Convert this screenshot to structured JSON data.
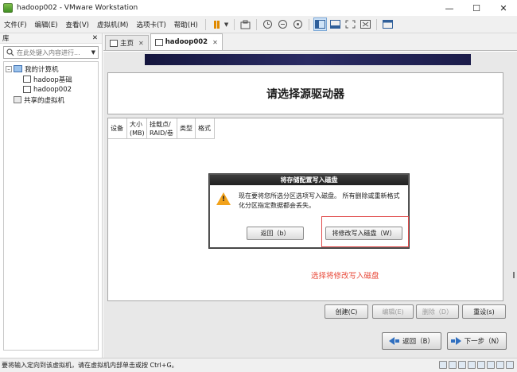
{
  "window": {
    "title": "hadoop002 - VMware Workstation"
  },
  "menu": [
    "文件(F)",
    "编辑(E)",
    "查看(V)",
    "虚拟机(M)",
    "选项卡(T)",
    "帮助(H)"
  ],
  "library": {
    "title": "库",
    "search_placeholder": "在此处键入内容进行...",
    "tree": [
      {
        "label": "我的计算机",
        "level": 0
      },
      {
        "label": "hadoop基础",
        "level": 1
      },
      {
        "label": "hadoop002",
        "level": 1
      },
      {
        "label": "共享的虚拟机",
        "level": 0
      }
    ]
  },
  "tabs": [
    {
      "label": "主页"
    },
    {
      "label": "hadoop002"
    }
  ],
  "installer": {
    "title": "请选择源驱动器",
    "columns": [
      "设备",
      "大小\n(MB)",
      "挂载点/\nRAID/卷",
      "类型",
      "格式"
    ]
  },
  "dialog": {
    "title": "将存储配置写入磁盘",
    "message": "现在要将您所选分区选项写入磁盘。 所有删除或重新格式化分区指定数据都会丢失。",
    "back_label": "返回（b）",
    "write_label": "将修改写入磁盘（W）"
  },
  "annotation": "选择将修改写入磁盘",
  "actions": {
    "create": "创建(C)",
    "edit": "编辑(E)",
    "delete": "删除（D）",
    "reset": "重设(s)"
  },
  "nav": {
    "back": "返回（B）",
    "next": "下一步（N）"
  },
  "status": {
    "text": "要将输入定向到该虚拟机，请在虚拟机内部单击或按 Ctrl+G。"
  }
}
